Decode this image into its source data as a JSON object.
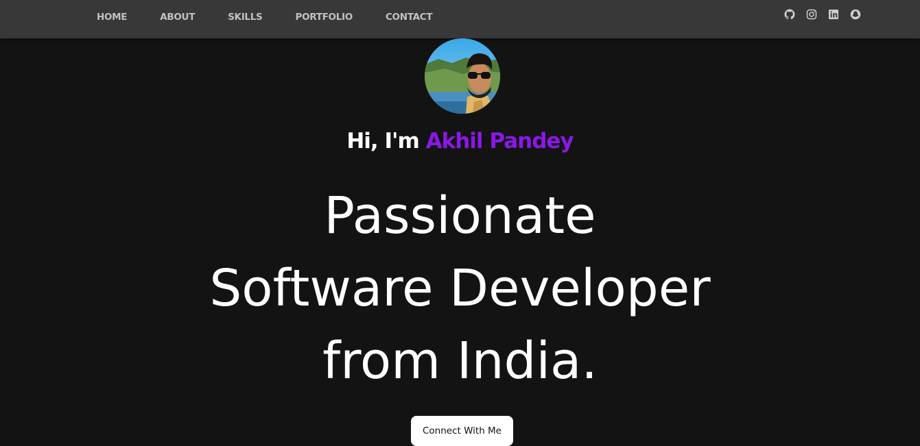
{
  "nav": {
    "items": [
      {
        "label": "HOME"
      },
      {
        "label": "ABOUT"
      },
      {
        "label": "SKILLS"
      },
      {
        "label": "PORTFOLIO"
      },
      {
        "label": "CONTACT"
      }
    ]
  },
  "social": {
    "icons": [
      "github-icon",
      "instagram-icon",
      "linkedin-icon",
      "snapchat-icon"
    ],
    "color": "#d0d0d0"
  },
  "hero": {
    "greeting_prefix": "Hi, I'm ",
    "name": "Akhil Pandey",
    "headline_lines": [
      "Passionate",
      "Software Developer",
      "from India."
    ],
    "cta_label": "Connect With Me"
  },
  "colors": {
    "background": "#131313",
    "navbar": "#383838",
    "accent": "#8a18e6",
    "text": "#ffffff"
  }
}
